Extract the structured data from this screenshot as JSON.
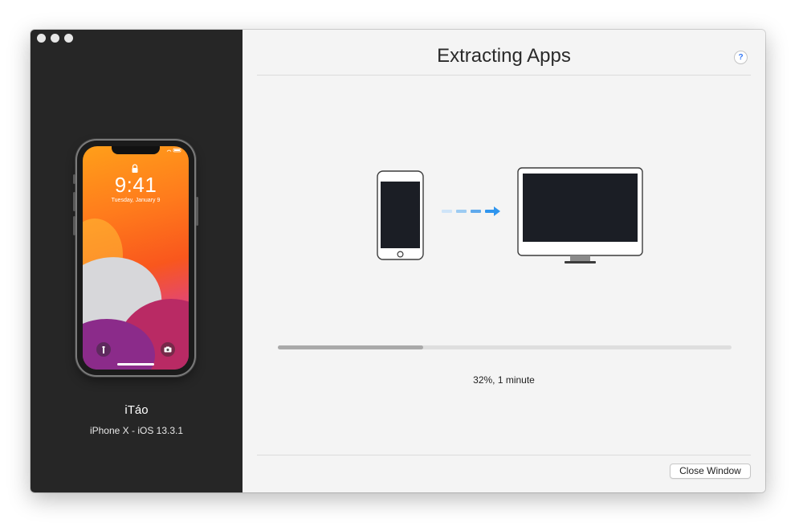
{
  "sidebar": {
    "device": {
      "name": "iTáo",
      "info": "iPhone X - iOS 13.3.1",
      "lock_screen": {
        "time": "9:41",
        "date": "Tuesday, January 9"
      }
    }
  },
  "main": {
    "title": "Extracting Apps",
    "help_label": "?",
    "illustration": {
      "source_icon": "iphone-icon",
      "target_icon": "imac-icon",
      "transfer_icon": "dashed-arrow-icon",
      "accent_color": "#2f95ee"
    },
    "progress": {
      "value": 0.32,
      "text": "32%, 1 minute"
    },
    "close_button_label": "Close Window"
  },
  "colors": {
    "sidebar_bg": "#262626",
    "main_bg": "#f4f4f4",
    "progress_fill": "#a9a9a9",
    "progress_track": "#dedede"
  }
}
